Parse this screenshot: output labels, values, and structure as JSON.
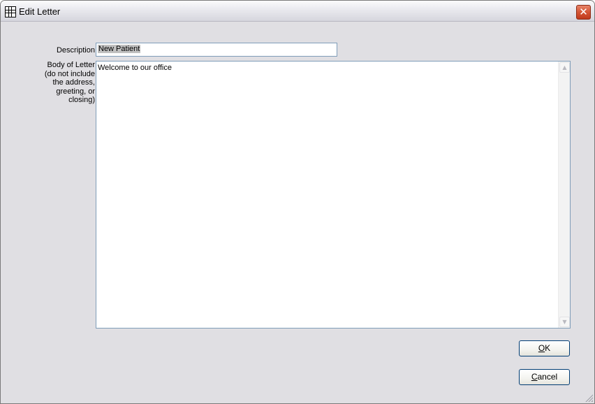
{
  "window": {
    "title": "Edit Letter",
    "close_glyph": "✕"
  },
  "form": {
    "description_label": "Description",
    "description_value": "New Patient",
    "body_label_lines": [
      "Body of Letter",
      "(do not include",
      "the address,",
      "greeting, or",
      "closing)"
    ],
    "body_value": "Welcome to our office"
  },
  "buttons": {
    "ok_mnemonic": "O",
    "ok_rest": "K",
    "cancel_mnemonic": "C",
    "cancel_rest": "ancel"
  },
  "icons": {
    "app": "grid-icon",
    "close": "close-icon",
    "scroll_up": "scroll-up-arrow-icon",
    "scroll_down": "scroll-down-arrow-icon",
    "resize": "resize-grip-icon"
  }
}
